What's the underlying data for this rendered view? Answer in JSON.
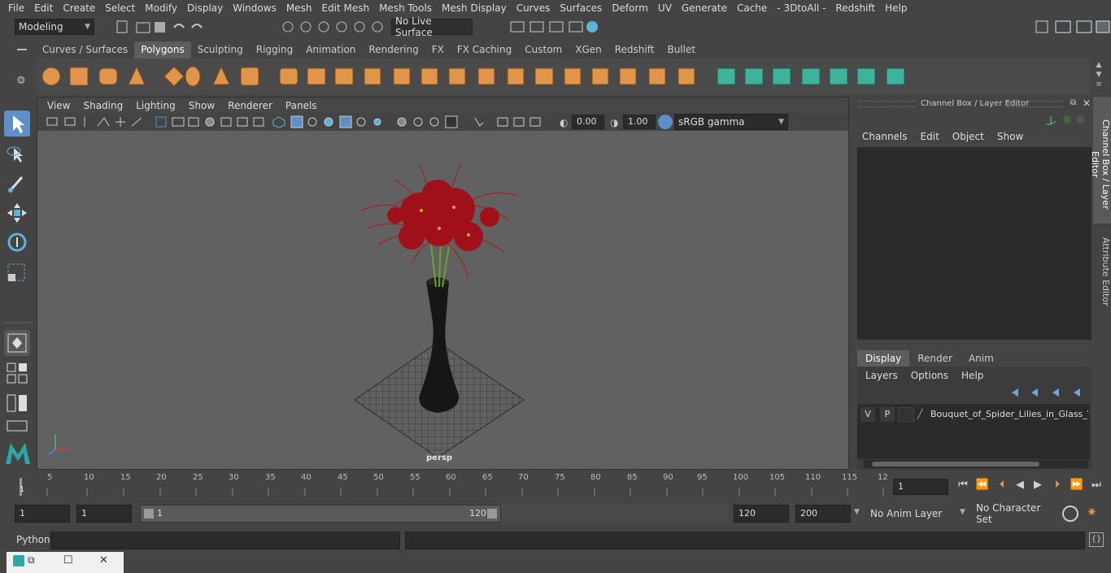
{
  "menubar": {
    "items": [
      "File",
      "Edit",
      "Create",
      "Select",
      "Modify",
      "Display",
      "Windows",
      "Mesh",
      "Edit Mesh",
      "Mesh Tools",
      "Mesh Display",
      "Curves",
      "Surfaces",
      "Deform",
      "UV",
      "Generate",
      "Cache",
      "- 3DtoAll -",
      "Redshift",
      "Help"
    ]
  },
  "status": {
    "mode": "Modeling",
    "live_surface": "No Live Surface"
  },
  "shelf_tabs": [
    "Curves / Surfaces",
    "Polygons",
    "Sculpting",
    "Rigging",
    "Animation",
    "Rendering",
    "FX",
    "FX Caching",
    "Custom",
    "XGen",
    "Redshift",
    "Bullet"
  ],
  "viewport": {
    "menu": [
      "View",
      "Shading",
      "Lighting",
      "Show",
      "Renderer",
      "Panels"
    ],
    "exposure": "0.00",
    "gamma": "1.00",
    "color_space": "sRGB gamma",
    "camera_label": "persp"
  },
  "channel_box": {
    "title": "Channel Box / Layer Editor",
    "menu": [
      "Channels",
      "Edit",
      "Object",
      "Show"
    ]
  },
  "layer_editor": {
    "tabs": [
      "Display",
      "Render",
      "Anim"
    ],
    "menu": [
      "Layers",
      "Options",
      "Help"
    ],
    "layer": {
      "v": "V",
      "p": "P",
      "name": "Bouquet_of_Spider_Lilies_in_Glass_Va"
    }
  },
  "side_tabs": {
    "channel": "Channel Box / Layer Editor",
    "attribute": "Attribute Editor"
  },
  "timeline": {
    "ticks": [
      "5",
      "10",
      "15",
      "20",
      "25",
      "30",
      "35",
      "40",
      "45",
      "50",
      "55",
      "60",
      "65",
      "70",
      "75",
      "80",
      "85",
      "90",
      "95",
      "100",
      "105",
      "110",
      "115",
      "12"
    ],
    "start_marker": "1",
    "current_frame": "1"
  },
  "range": {
    "start": "1",
    "current": "1",
    "slider_start": "1",
    "slider_end": "120",
    "end": "120",
    "max": "200",
    "anim_layer": "No Anim Layer",
    "character_set": "No Character Set"
  },
  "cmdline": {
    "label": "Python"
  },
  "colors": {
    "accent": "#5d8fc9",
    "shelf_orange": "#e0954a",
    "shelf_teal": "#3fb39a",
    "lily_red": "#b3121b"
  }
}
